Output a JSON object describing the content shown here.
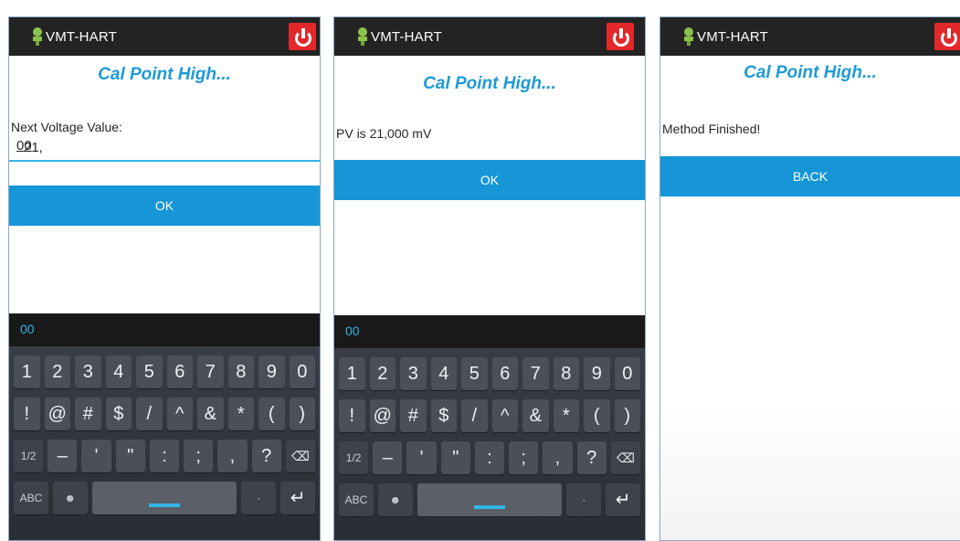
{
  "app": {
    "title": "VMT-HART",
    "heading": "Cal Point High..."
  },
  "screens": [
    {
      "label": "Next Voltage Value:",
      "input_value_prefix": "21,",
      "input_value_underlined": "00",
      "ok_label": "OK",
      "keyboard": {
        "suggestion": "00",
        "row1": [
          "1",
          "2",
          "3",
          "4",
          "5",
          "6",
          "7",
          "8",
          "9",
          "0"
        ],
        "row2": [
          "!",
          "@",
          "#",
          "$",
          "/",
          "^",
          "&",
          "*",
          "(",
          ")"
        ],
        "row3": [
          "1/2",
          "–",
          "'",
          "\"",
          ":",
          ";",
          ",",
          "?",
          "⌫"
        ],
        "row4": [
          "ABC",
          "☻",
          "",
          "·",
          "↵"
        ]
      }
    },
    {
      "label": "PV is 21,000 mV",
      "ok_label": "OK",
      "keyboard": {
        "suggestion": "00",
        "row1": [
          "1",
          "2",
          "3",
          "4",
          "5",
          "6",
          "7",
          "8",
          "9",
          "0"
        ],
        "row2": [
          "!",
          "@",
          "#",
          "$",
          "/",
          "^",
          "&",
          "*",
          "(",
          ")"
        ],
        "row3": [
          "1/2",
          "–",
          "'",
          "\"",
          ":",
          ";",
          ",",
          "?",
          "⌫"
        ],
        "row4": [
          "ABC",
          "☻",
          "",
          "·",
          "↵"
        ]
      }
    },
    {
      "label": "Method Finished!",
      "back_label": "BACK"
    }
  ],
  "colors": {
    "accent": "#1696d6",
    "heading": "#1e9ad6",
    "power": "#e3282b",
    "appbar": "#232323"
  },
  "icons": {
    "logo": "robot-logo-icon",
    "power": "power-icon"
  }
}
